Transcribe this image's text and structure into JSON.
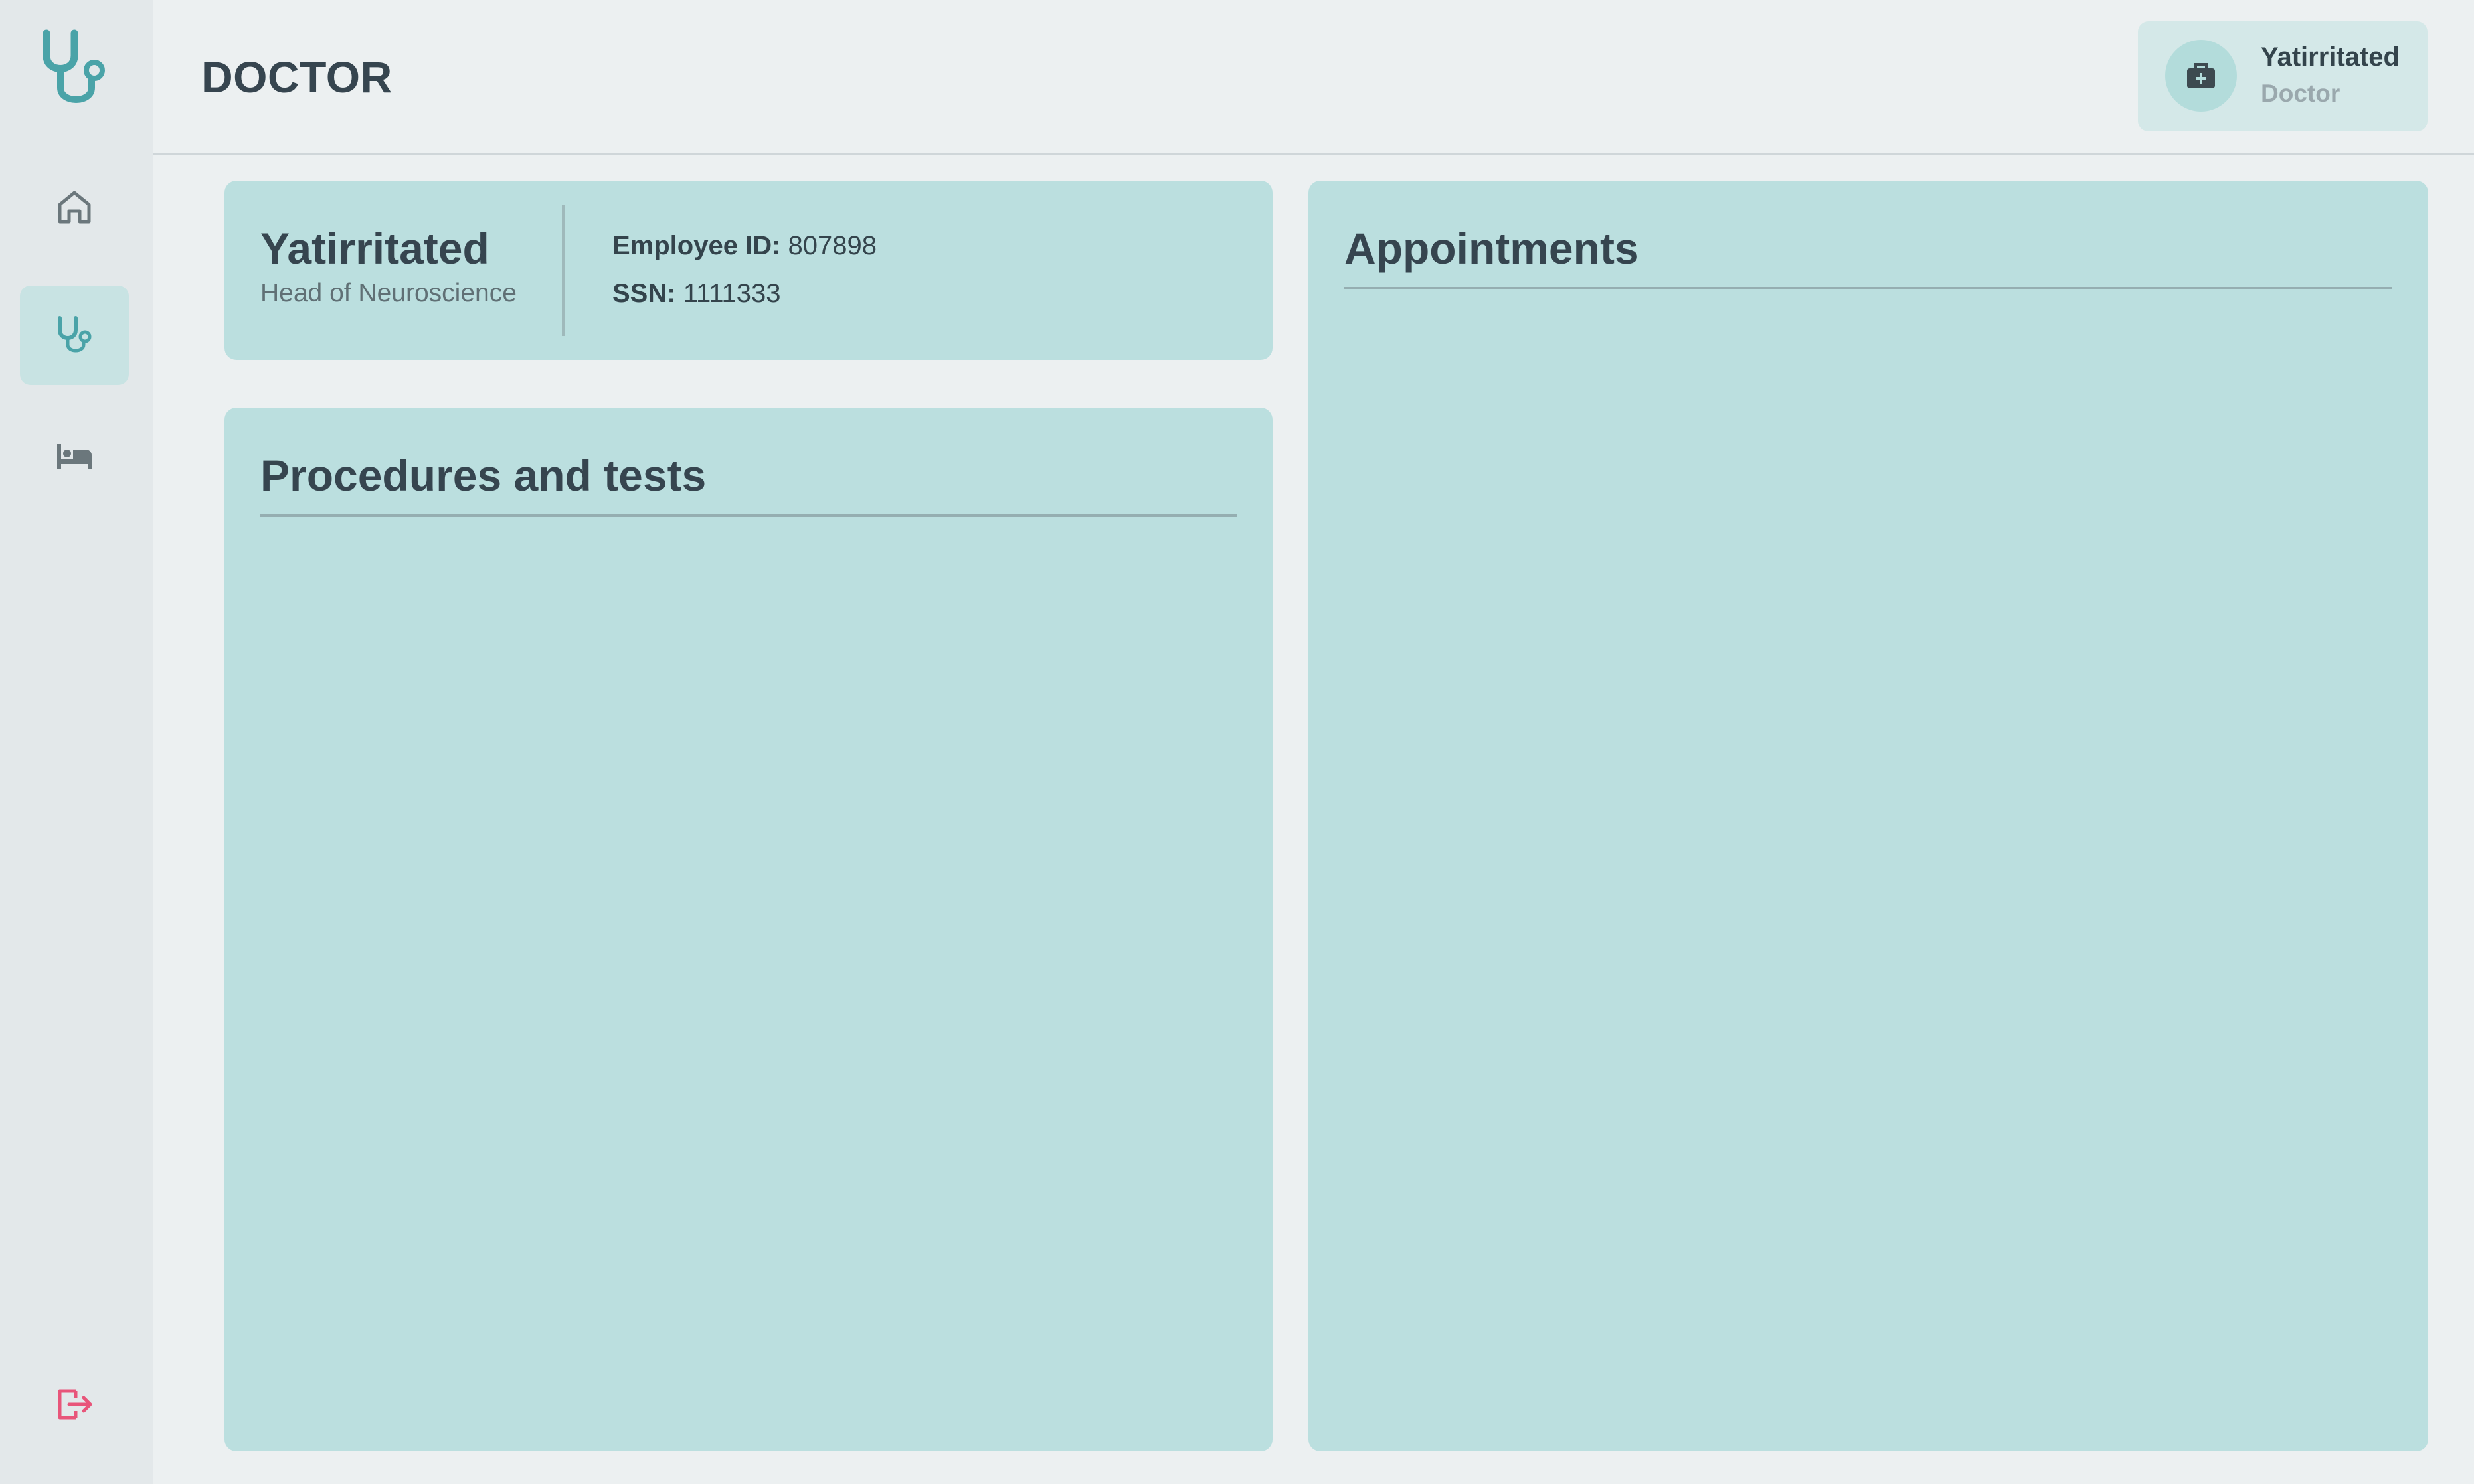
{
  "sidebar": {
    "logo_icon": "stethoscope-icon",
    "items": [
      {
        "id": "home",
        "icon": "home-icon",
        "active": false
      },
      {
        "id": "doctor",
        "icon": "stethoscope-icon",
        "active": true
      },
      {
        "id": "patients",
        "icon": "bed-icon",
        "active": false
      }
    ],
    "logout_icon": "logout-icon"
  },
  "header": {
    "title": "DOCTOR",
    "user": {
      "name": "Yatirritated",
      "role": "Doctor",
      "avatar_icon": "medical-briefcase-icon"
    }
  },
  "profile": {
    "name": "Yatirritated",
    "title": "Head of Neuroscience",
    "employee_id_label": "Employee ID:",
    "employee_id": "807898",
    "ssn_label": "SSN:",
    "ssn": "1111333"
  },
  "procedures": {
    "heading": "Procedures and tests",
    "items": []
  },
  "appointments": {
    "heading": "Appointments",
    "items": []
  },
  "colors": {
    "accent": "#4aa3a8",
    "card": "#bbdfdf",
    "logout": "#e8557a",
    "background": "#ecf0f1",
    "sidebar": "#e3e8ea"
  }
}
